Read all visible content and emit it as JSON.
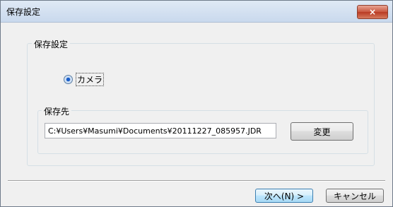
{
  "window": {
    "title": "保存設定",
    "close_label": "×"
  },
  "group": {
    "label": "保存設定"
  },
  "radio": {
    "label": "カメラ",
    "selected": true
  },
  "destination": {
    "label": "保存先",
    "path": "C:¥Users¥Masumi¥Documents¥20111227_085957.JDR",
    "change_button": "変更"
  },
  "footer": {
    "next_button": "次へ(N) >",
    "cancel_button": "キャンセル"
  }
}
